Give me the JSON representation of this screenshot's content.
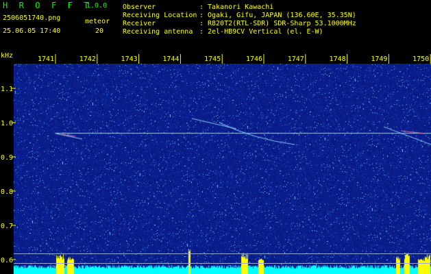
{
  "header": {
    "app_title": "H R O F F T",
    "app_version": "1.0.0",
    "filename": "2506051740.png",
    "observation_datetime": "25.06.05 17:40",
    "meteor_label": "meteor",
    "meteor_count": "20"
  },
  "info": {
    "rows": [
      {
        "key": "Observer",
        "value": "Takanori Kawachi"
      },
      {
        "key": "Receiving Location",
        "value": "Ogaki, Gifu, JAPAN (136.60E, 35.35N)"
      },
      {
        "key": "Receiver",
        "value": "R820T2(RTL-SDR) SDR-Sharp 53.1000MHz"
      },
      {
        "key": "Receiving antenna",
        "value": "2el-HB9CV Vertical (el. E-W)"
      }
    ],
    "separator": ":"
  },
  "axes": {
    "y_unit": "kHz",
    "x_ticks": [
      "1741",
      "1742",
      "1743",
      "1744",
      "1745",
      "1746",
      "1747",
      "1748",
      "1749",
      "1750"
    ],
    "y_ticks": [
      "1.1",
      "1.0",
      "0.9",
      "0.8",
      "0.7",
      "0.6"
    ]
  },
  "colors": {
    "header_green": "#00ff00",
    "header_yellow": "#ffff00",
    "background_blue": "#0a1a8a",
    "tick_yellow": "#ffff00",
    "bottom_trace_cyan": "#00ffff",
    "burst_yellow": "#ffff00"
  }
}
